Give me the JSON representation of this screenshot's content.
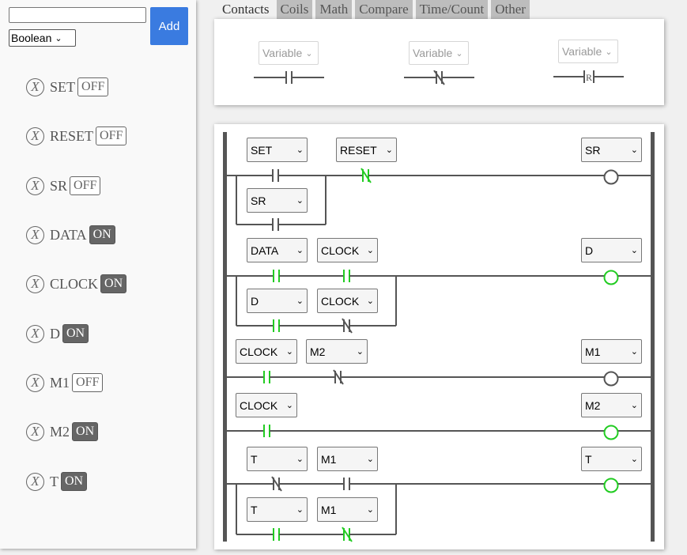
{
  "toolbar": {
    "var_input_value": "",
    "type_selected": "Boolean",
    "type_options": [
      "Boolean"
    ],
    "add_label": "Add"
  },
  "variables": [
    {
      "name": "SET",
      "state": "OFF"
    },
    {
      "name": "RESET",
      "state": "OFF"
    },
    {
      "name": "SR",
      "state": "OFF"
    },
    {
      "name": "DATA",
      "state": "ON"
    },
    {
      "name": "CLOCK",
      "state": "ON"
    },
    {
      "name": "D",
      "state": "ON"
    },
    {
      "name": "M1",
      "state": "OFF"
    },
    {
      "name": "M2",
      "state": "ON"
    },
    {
      "name": "T",
      "state": "ON"
    }
  ],
  "remove_glyph": "X",
  "tabs": [
    "Contacts",
    "Coils",
    "Math",
    "Compare",
    "Time/Count",
    "Other"
  ],
  "active_tab": "Contacts",
  "palette": [
    {
      "label": "Variable",
      "contact": "no"
    },
    {
      "label": "Variable",
      "contact": "nc"
    },
    {
      "label": "Variable",
      "contact": "reset",
      "mark": "R"
    }
  ],
  "ladder": {
    "rung1": {
      "set": "SET",
      "reset": "RESET",
      "coil": "SR",
      "branch": "SR"
    },
    "rung2": {
      "data": "DATA",
      "clock": "CLOCK",
      "coil": "D",
      "branch_d": "D",
      "branch_clock": "CLOCK"
    },
    "rung3": {
      "clock": "CLOCK",
      "m2": "M2",
      "coil": "M1"
    },
    "rung4": {
      "clock": "CLOCK",
      "coil": "M2"
    },
    "rung5": {
      "t": "T",
      "m1": "M1",
      "coil": "T",
      "branch_t": "T",
      "branch_m1": "M1"
    }
  },
  "colors": {
    "accent": "#3a7be0",
    "energized": "#22cc22",
    "wire": "#555555",
    "on_button_bg": "#666666"
  }
}
